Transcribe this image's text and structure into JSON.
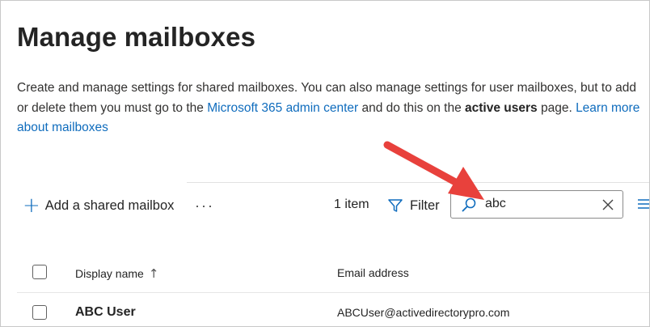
{
  "page": {
    "title": "Manage mailboxes",
    "description": {
      "part1": "Create and manage settings for shared mailboxes. You can also manage settings for user mailboxes, but to add or delete them you must go to the ",
      "link1": "Microsoft 365 admin center",
      "part2": " and do this on the ",
      "bold": "active users",
      "part3": " page. ",
      "link2": "Learn more about mailboxes"
    }
  },
  "toolbar": {
    "add_label": "Add a shared mailbox",
    "more_label": "···",
    "item_count": "1 item",
    "filter_label": "Filter",
    "search_value": "abc"
  },
  "table": {
    "columns": {
      "display_name": "Display name",
      "email": "Email address"
    },
    "rows": [
      {
        "display_name": "ABC User",
        "email": "ABCUser@activedirectorypro.com"
      }
    ]
  },
  "colors": {
    "accent": "#0f6cbd",
    "annotation_arrow": "#e8413c"
  },
  "icons": [
    "plus-icon",
    "more-icon",
    "filter-icon",
    "search-icon",
    "close-icon",
    "list-view-icon",
    "sort-arrow-up-icon",
    "annotation-arrow"
  ]
}
